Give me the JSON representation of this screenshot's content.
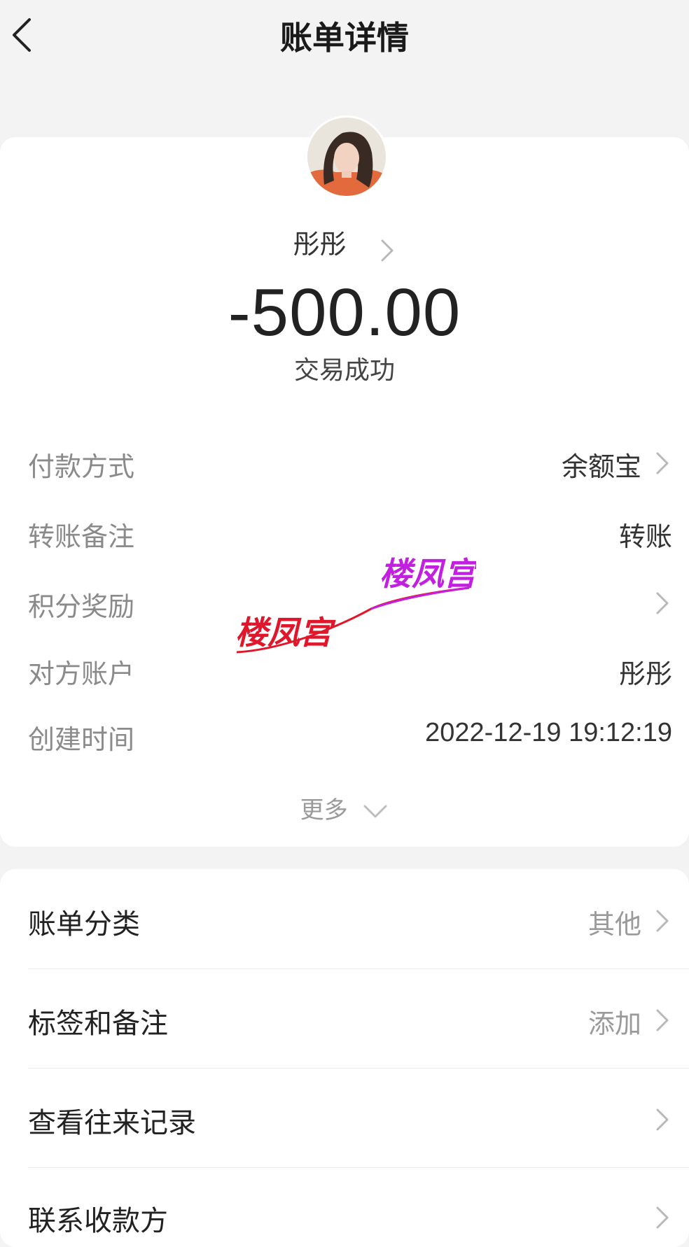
{
  "header": {
    "title": "账单详情"
  },
  "payee": {
    "name": "彤彤"
  },
  "transaction": {
    "amount": "-500.00",
    "status": "交易成功"
  },
  "details": [
    {
      "label": "付款方式",
      "value": "余额宝",
      "chevron": true
    },
    {
      "label": "转账备注",
      "value": "转账",
      "chevron": false
    },
    {
      "label": "积分奖励",
      "value": "",
      "chevron": true
    },
    {
      "label": "对方账户",
      "value": "彤彤",
      "chevron": false
    },
    {
      "label": "创建时间",
      "value": "2022-12-19 19:12:19",
      "chevron": false
    }
  ],
  "more_label": "更多",
  "actions": [
    {
      "label": "账单分类",
      "value": "其他"
    },
    {
      "label": "标签和备注",
      "value": "添加"
    },
    {
      "label": "查看往来记录",
      "value": ""
    },
    {
      "label": "联系收款方",
      "value": ""
    }
  ],
  "watermark": {
    "text_1": "楼凤宫",
    "text_2": "楼凤宫",
    "color_1": "#e0162b",
    "color_2": "#c21fe0"
  }
}
